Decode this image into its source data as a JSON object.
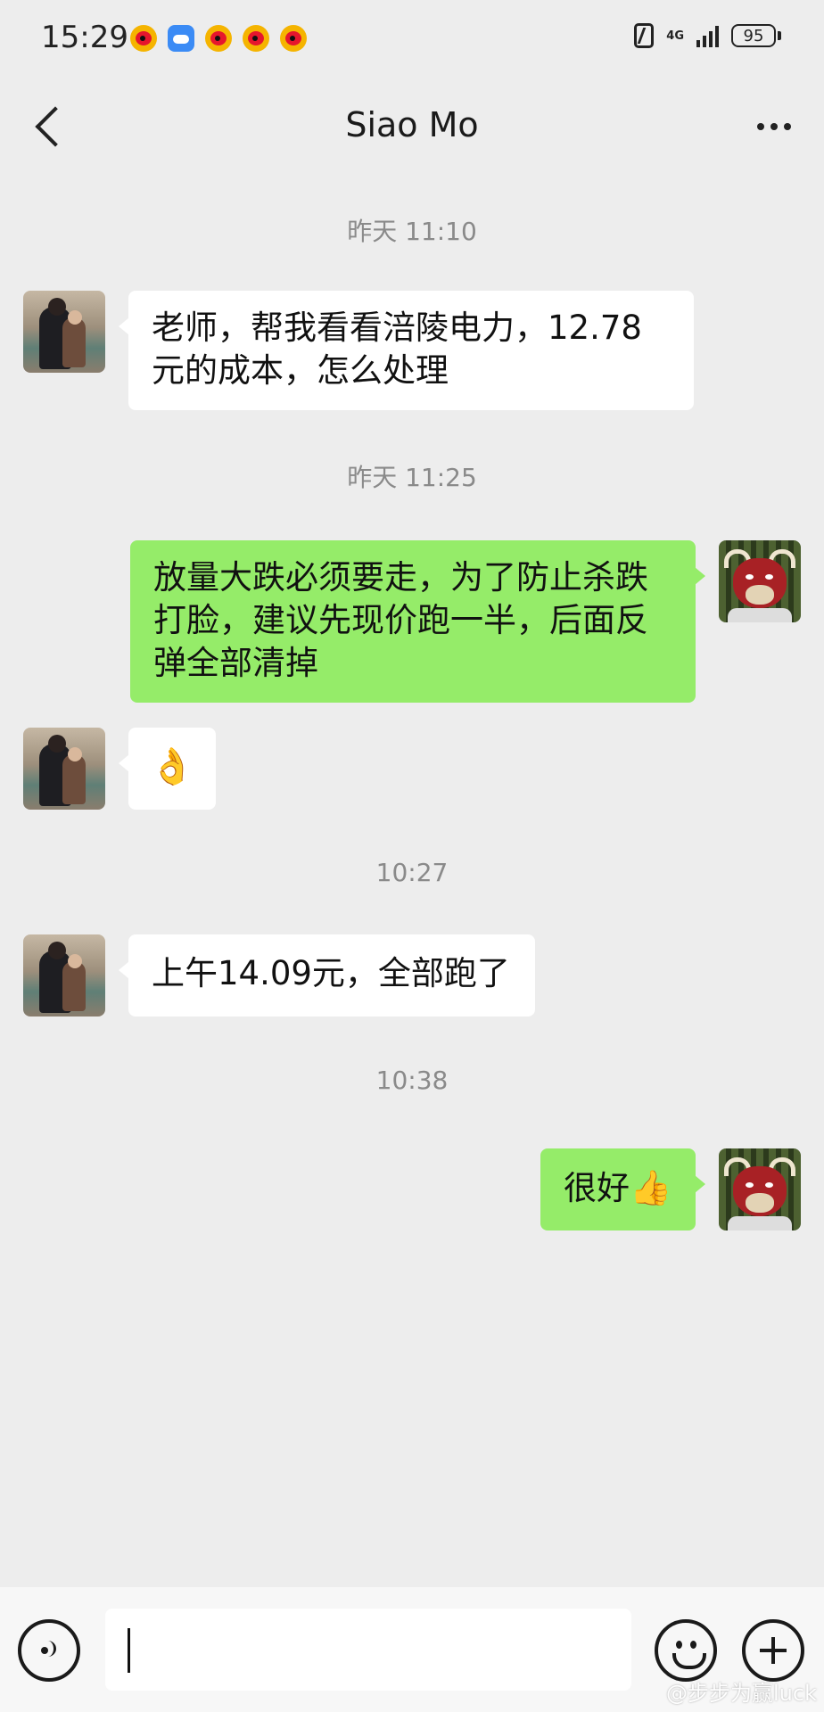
{
  "status_bar": {
    "time": "15:29",
    "notification_icons": [
      "weibo-icon",
      "cloud-icon",
      "weibo-icon",
      "weibo-icon",
      "weibo-icon"
    ],
    "network": "4G",
    "battery": "95"
  },
  "header": {
    "title": "Siao Mo"
  },
  "messages": [
    {
      "type": "time",
      "text": "昨天 11:10"
    },
    {
      "type": "incoming",
      "text": "老师，帮我看看涪陵电力，12.78元的成本，怎么处理"
    },
    {
      "type": "time",
      "text": "昨天 11:25"
    },
    {
      "type": "outgoing",
      "text": "放量大跌必须要走，为了防止杀跌打脸，建议先现价跑一半，后面反弹全部清掉"
    },
    {
      "type": "incoming",
      "text": "👌"
    },
    {
      "type": "time",
      "text": "10:27"
    },
    {
      "type": "incoming",
      "text": "上午14.09元，全部跑了"
    },
    {
      "type": "time",
      "text": "10:38"
    },
    {
      "type": "outgoing",
      "text": "很好",
      "emoji": "👍"
    }
  ],
  "input_bar": {
    "placeholder": ""
  },
  "watermark": "@步步为赢luck",
  "colors": {
    "background": "#ededed",
    "incoming_bubble": "#ffffff",
    "outgoing_bubble": "#95ec69",
    "timestamp": "#8a8a8a"
  }
}
